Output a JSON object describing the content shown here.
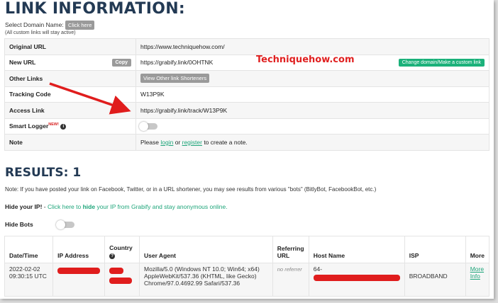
{
  "link_info": {
    "heading": "LINK INFORMATION:",
    "select_domain_label": "Select Domain Name:",
    "click_here_label": "Click here",
    "custom_note": "(All custom links will stay active)",
    "rows": {
      "original_url": {
        "label": "Original URL",
        "value": "https://www.techniquehow.com/"
      },
      "new_url": {
        "label": "New URL",
        "value": "https://grabify.link/0OHTNK",
        "copy_label": "Copy",
        "change_label": "Change domain/Make a custom link"
      },
      "other_links": {
        "label": "Other Links",
        "button_label": "View Other link Shorteners"
      },
      "tracking_code": {
        "label": "Tracking Code",
        "value": "W13P9K"
      },
      "access_link": {
        "label": "Access Link",
        "value": "https://grabify.link/track/W13P9K"
      },
      "smart_logger": {
        "label": "Smart Logger",
        "badge": "NEW!",
        "info_icon": "i",
        "toggle_state": "off"
      },
      "note": {
        "label": "Note",
        "prefix": "Please ",
        "login": "login",
        "or": " or ",
        "register": "register",
        "suffix": " to create a note."
      }
    }
  },
  "watermark": "Techniquehow.com",
  "results": {
    "heading": "RESULTS: 1",
    "note": "Note: If you have posted your link on Facebook, Twitter, or in a URL shortener, you may see results from various \"bots\" (BitlyBot, FacebookBot, etc.)",
    "hide_ip": {
      "label": "Hide your IP!",
      "sep": " - ",
      "pre": "Click here to ",
      "bold": "hide",
      "post": " your IP from Grabify and stay anonymous online."
    },
    "hide_bots": {
      "label": "Hide Bots",
      "toggle_state": "off"
    },
    "columns": {
      "datetime": "Date/Time",
      "ip": "IP Address",
      "country": "Country",
      "country_icon": "?",
      "user_agent": "User Agent",
      "referring_1": "Referring",
      "referring_2": "URL",
      "host": "Host Name",
      "isp": "ISP",
      "more": "More"
    },
    "row": {
      "date": "2022-02-02",
      "time": "09:30:15 UTC",
      "ua_1": "Mozilla/5.0 (Windows NT 10.0; Win64; x64)",
      "ua_2": "AppleWebKit/537.36 (KHTML, like Gecko)",
      "ua_3": "Chrome/97.0.4692.99 Safari/537.36",
      "referrer": "no referrer",
      "host_prefix": "64-",
      "isp": "BROADBAND",
      "more_1": "More",
      "more_2": "Info"
    }
  },
  "colors": {
    "heading": "#233a54",
    "green": "#1bb17a",
    "red": "#e01d1d"
  }
}
